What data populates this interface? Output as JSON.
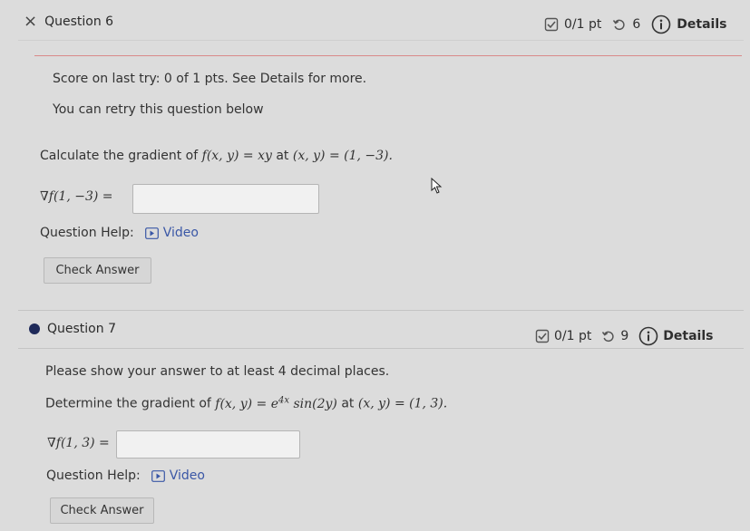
{
  "q6": {
    "close_symbol": "×",
    "title": "Question 6",
    "points": "0/1 pt",
    "retries": "6",
    "details": "Details",
    "score_note": "Score on last try: 0 of 1 pts. See Details for more.",
    "retry_note": "You can retry this question below",
    "prompt_prefix": "Calculate the gradient of ",
    "prompt_func": "f(x, y) = xy",
    "prompt_mid": " at ",
    "prompt_point": "(x, y) = (1, −3).",
    "answer_label": "∇f(1, −3) =",
    "help_label": "Question Help:",
    "video_label": "Video",
    "check_label": "Check Answer"
  },
  "q7": {
    "title": "Question 7",
    "points": "0/1 pt",
    "retries": "9",
    "details": "Details",
    "instruction": "Please show your answer to at least 4 decimal places.",
    "prompt_prefix": "Determine the gradient of ",
    "prompt_func_a": "f(x, y) = e",
    "prompt_func_exp": "4x",
    "prompt_func_b": " sin(2y)",
    "prompt_mid": " at ",
    "prompt_point": "(x, y) = (1, 3).",
    "answer_label": "∇f(1, 3) =",
    "help_label": "Question Help:",
    "video_label": "Video",
    "check_label": "Check Answer"
  },
  "colors": {
    "accent_red": "#d98a8a",
    "link_blue": "#3a57a6",
    "bullet": "#1f2a5a"
  },
  "icons": [
    "close-icon",
    "checkbox-icon",
    "retry-icon",
    "info-icon",
    "video-icon",
    "bullet-icon",
    "cursor-icon"
  ]
}
